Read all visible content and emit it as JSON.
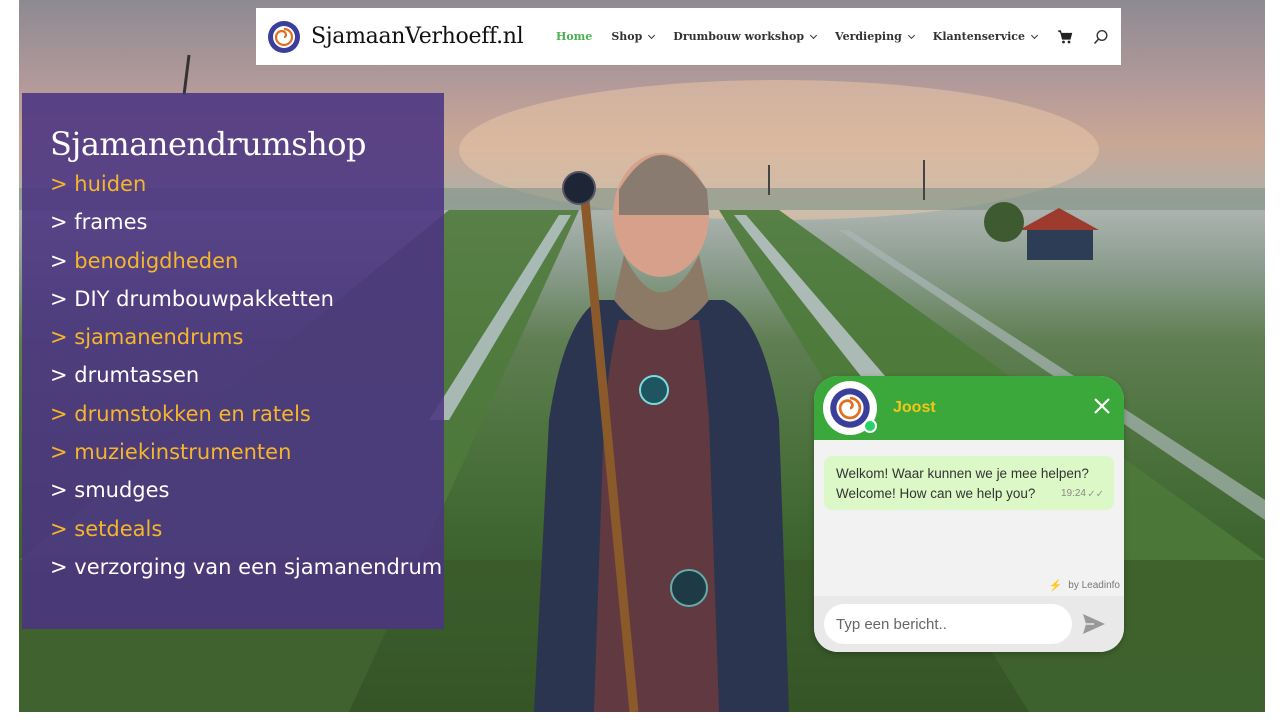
{
  "header": {
    "site_name": "SjamaanVerhoeff.nl",
    "nav": [
      {
        "label": "Home",
        "active": true,
        "has_dropdown": false
      },
      {
        "label": "Shop",
        "active": false,
        "has_dropdown": true
      },
      {
        "label": "Drumbouw workshop",
        "active": false,
        "has_dropdown": true
      },
      {
        "label": "Verdieping",
        "active": false,
        "has_dropdown": true
      },
      {
        "label": "Klantenservice",
        "active": false,
        "has_dropdown": true
      }
    ],
    "icons": [
      "cart-icon",
      "search-icon"
    ]
  },
  "panel": {
    "title": "Sjamanendrumshop",
    "items": [
      {
        "label": "> huiden",
        "color": "orange"
      },
      {
        "label": "> frames",
        "color": "white"
      },
      {
        "label": "> benodigdheden",
        "color": "mixed"
      },
      {
        "label": "> DIY drumbouwpakketten",
        "color": "white"
      },
      {
        "label": "> sjamanendrums",
        "color": "orange"
      },
      {
        "label": "> drumtassen",
        "color": "white"
      },
      {
        "label": "> drumstokken en ratels",
        "color": "orange"
      },
      {
        "label": "> muziekinstrumenten",
        "color": "orange"
      },
      {
        "label": "> smudges",
        "color": "white"
      },
      {
        "label": "> setdeals",
        "color": "orange"
      },
      {
        "label": "> verzorging van een sjamanendrum",
        "color": "white"
      }
    ]
  },
  "chat": {
    "agent_name": "Joost",
    "message_line1": "Welkom! Waar kunnen we je mee helpen?",
    "message_line2": "Welcome! How can we help you?",
    "message_time": "19:24",
    "powered_by": "by Leadinfo",
    "input_placeholder": "Typ een bericht.."
  },
  "colors": {
    "accent_green": "#4caf50",
    "panel_purple": "#4b3482",
    "link_orange": "#f5b52c",
    "chat_green": "#3aa83a"
  }
}
